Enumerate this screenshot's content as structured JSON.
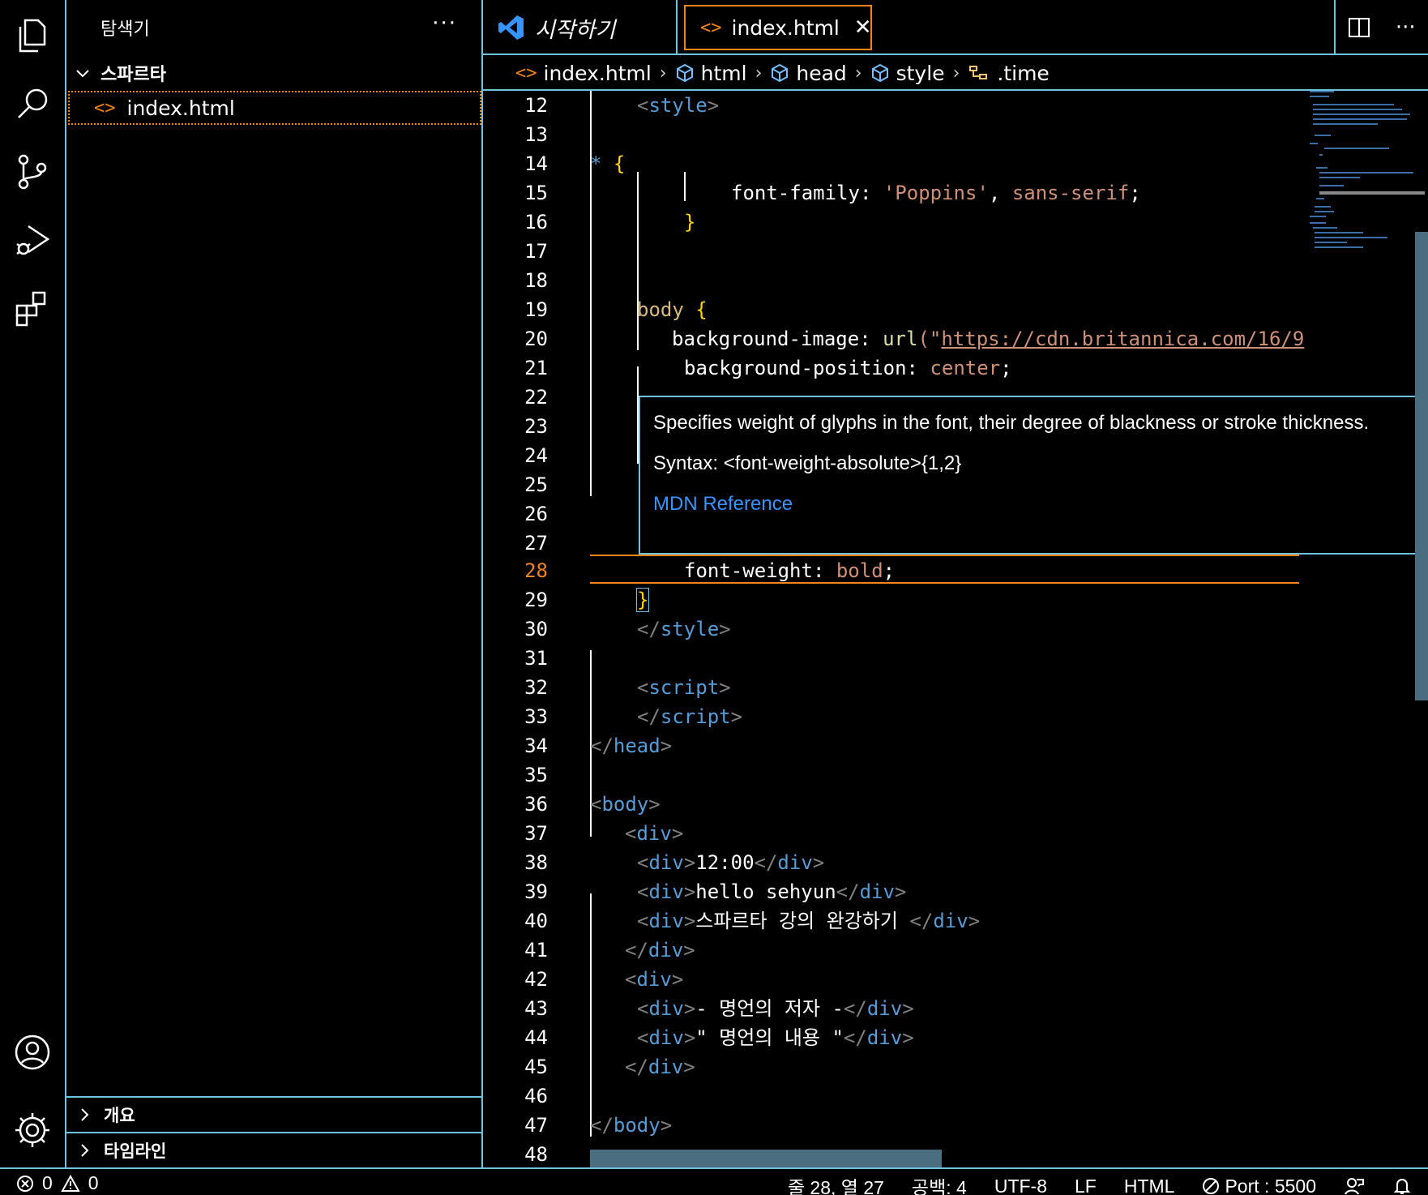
{
  "sidebar": {
    "title": "탐색기",
    "more": "···",
    "folder": "스파르타",
    "file": "index.html",
    "sections": [
      "개요",
      "타임라인"
    ]
  },
  "tabs": {
    "start": "시작하기",
    "active": "index.html",
    "close": "✕"
  },
  "breadcrumb": [
    "index.html",
    "html",
    "head",
    "style",
    ".time"
  ],
  "hover": {
    "description": "Specifies weight of glyphs in the font, their degree of blackness or stroke thickness.",
    "syntax": "Syntax: <font-weight-absolute>{1,2}",
    "link": "MDN Reference"
  },
  "code": {
    "l12": "<style>",
    "l14_star": "*",
    "l15_prop": "font-family",
    "l15_val1": "'Poppins'",
    "l15_val2": "sans-serif",
    "l19_sel": "body",
    "l20_prop": "background-image",
    "l20_fn": "url",
    "l20_url": "https://cdn.britannica.com/16/9",
    "l21_prop": "background-position",
    "l21_val": "center",
    "l28_prop": "font-weight",
    "l28_val": "bold",
    "l38_text": "12:00",
    "l39_text": "hello sehyun",
    "l40_text": "스파르타 강의 완강하기 ",
    "l43_text": "- 명언의 저자 -",
    "l44_text": "\" 명언의 내용 \""
  },
  "status": {
    "errors": "0",
    "warnings": "0",
    "position": "줄 28, 열 27",
    "spaces": "공백: 4",
    "encoding": "UTF-8",
    "eol": "LF",
    "language": "HTML",
    "port": "Port : 5500"
  }
}
